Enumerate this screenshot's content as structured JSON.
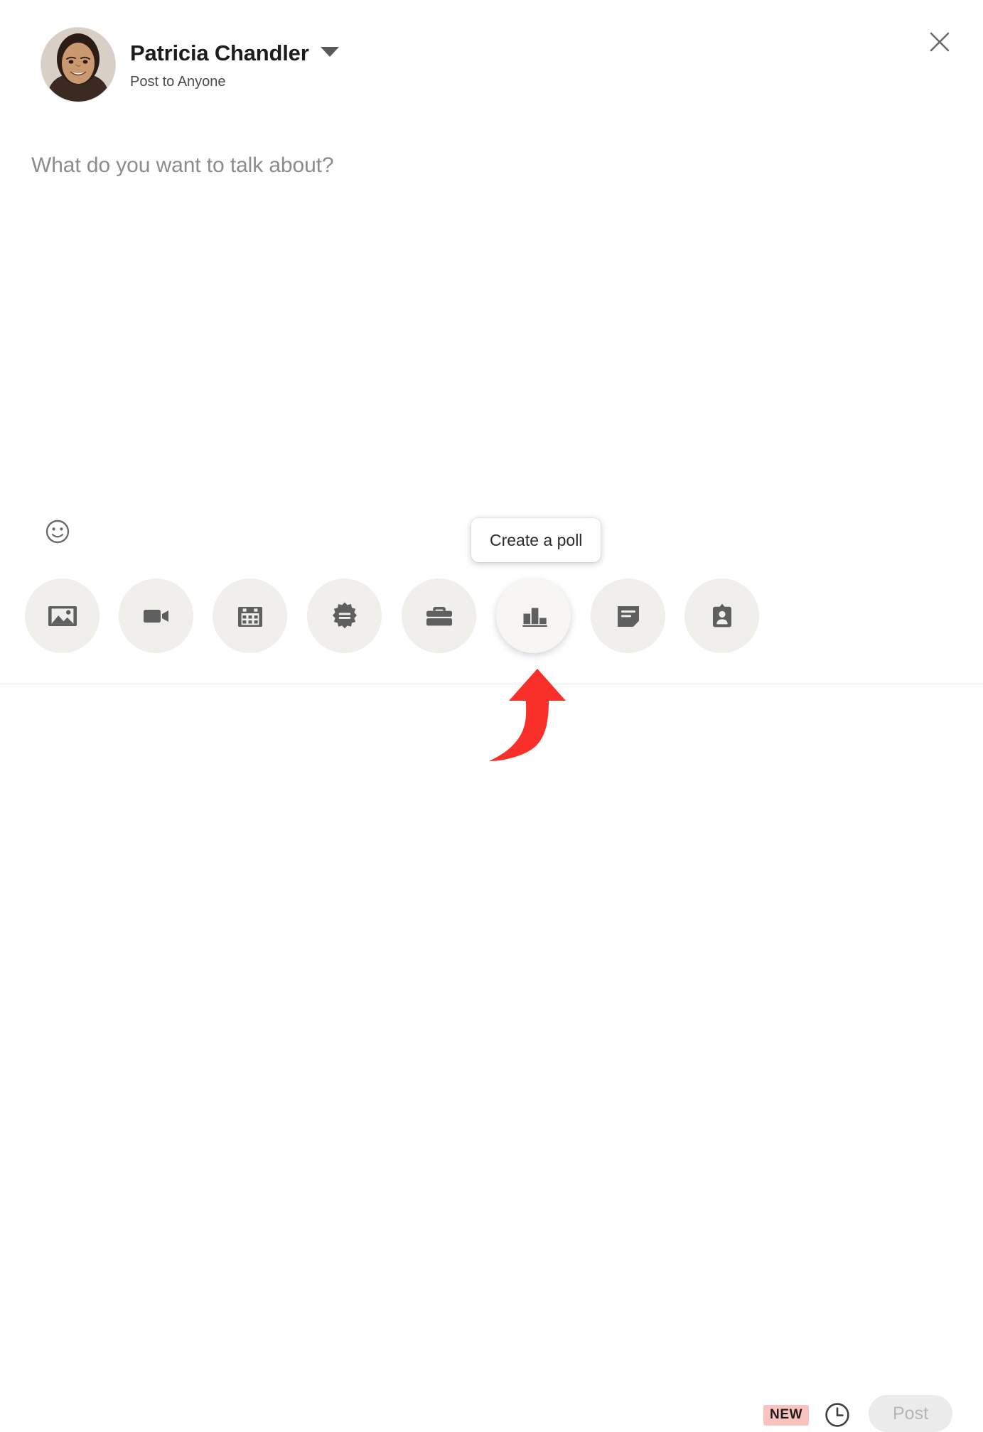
{
  "header": {
    "author_name": "Patricia Chandler",
    "audience": "Post to Anyone",
    "audience_caret_icon": "chevron-down-icon",
    "avatar_alt": "Patricia Chandler profile photo",
    "close_icon": "close-icon"
  },
  "editor": {
    "placeholder": "What do you want to talk about?",
    "value": ""
  },
  "emoji": {
    "icon": "emoji-smiley-icon",
    "label": "Open emoji keyboard"
  },
  "tooltip": {
    "text": "Create a poll",
    "visible": true,
    "anchor": "poll-button"
  },
  "media_toolbar": {
    "items": [
      {
        "label": "Add a photo",
        "icon": "image-icon",
        "hovered": false
      },
      {
        "label": "Add a video",
        "icon": "video-camera-icon",
        "hovered": false
      },
      {
        "label": "Create an event",
        "icon": "calendar-icon",
        "hovered": false
      },
      {
        "label": "Celebrate an occasion",
        "icon": "celebrate-badge-icon",
        "hovered": false
      },
      {
        "label": "Share that you're hiring",
        "icon": "briefcase-icon",
        "hovered": false
      },
      {
        "label": "Create a poll",
        "icon": "poll-bar-chart-icon",
        "hovered": true
      },
      {
        "label": "Write an article",
        "icon": "document-icon",
        "hovered": false
      },
      {
        "label": "Find an expert",
        "icon": "id-badge-icon",
        "hovered": false
      }
    ]
  },
  "bottom_bar": {
    "new_badge": "NEW",
    "schedule_icon": "clock-icon",
    "schedule_label": "Schedule post",
    "post_label": "Post",
    "post_disabled": true
  },
  "annotation": {
    "type": "curved-up-arrow",
    "color": "#f92f2a",
    "points_to": "poll-button"
  },
  "colors": {
    "page_background": "#ffffff",
    "media_button_fill": "#f0efeb",
    "media_button_hover_fill": "#f7f6f3",
    "icon_gray": "#5f5f5f",
    "divider": "#eaeaea",
    "new_badge_background": "#fac3c0",
    "post_button_background": "#ebebeb",
    "post_button_text": "#b6b6b6",
    "annotation_red": "#f92f2a"
  }
}
